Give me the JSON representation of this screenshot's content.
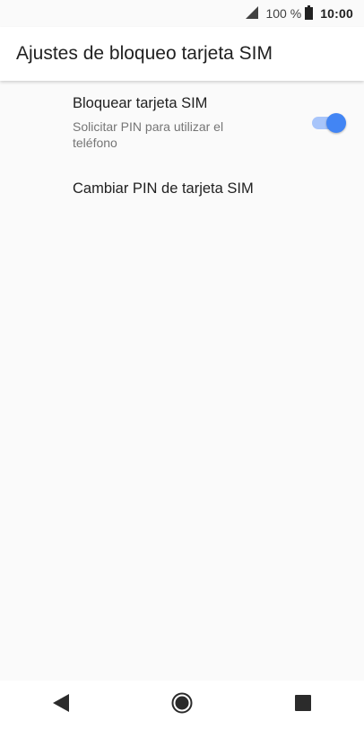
{
  "status_bar": {
    "battery_percent": "100 %",
    "time": "10:00",
    "signal_icon": "signal-icon",
    "battery_icon": "battery-icon"
  },
  "app_bar": {
    "title": "Ajustes de bloqueo tarjeta SIM"
  },
  "preferences": [
    {
      "title": "Bloquear tarjeta SIM",
      "summary": "Solicitar PIN para utilizar el teléfono",
      "toggle_on": true
    },
    {
      "title": "Cambiar PIN de tarjeta SIM"
    }
  ],
  "nav_bar": {
    "back_icon": "back-icon",
    "home_icon": "home-icon",
    "recents_icon": "recents-icon"
  },
  "colors": {
    "accent": "#4285f4",
    "accent_track": "#a8c5fa",
    "background": "#fafafa"
  }
}
